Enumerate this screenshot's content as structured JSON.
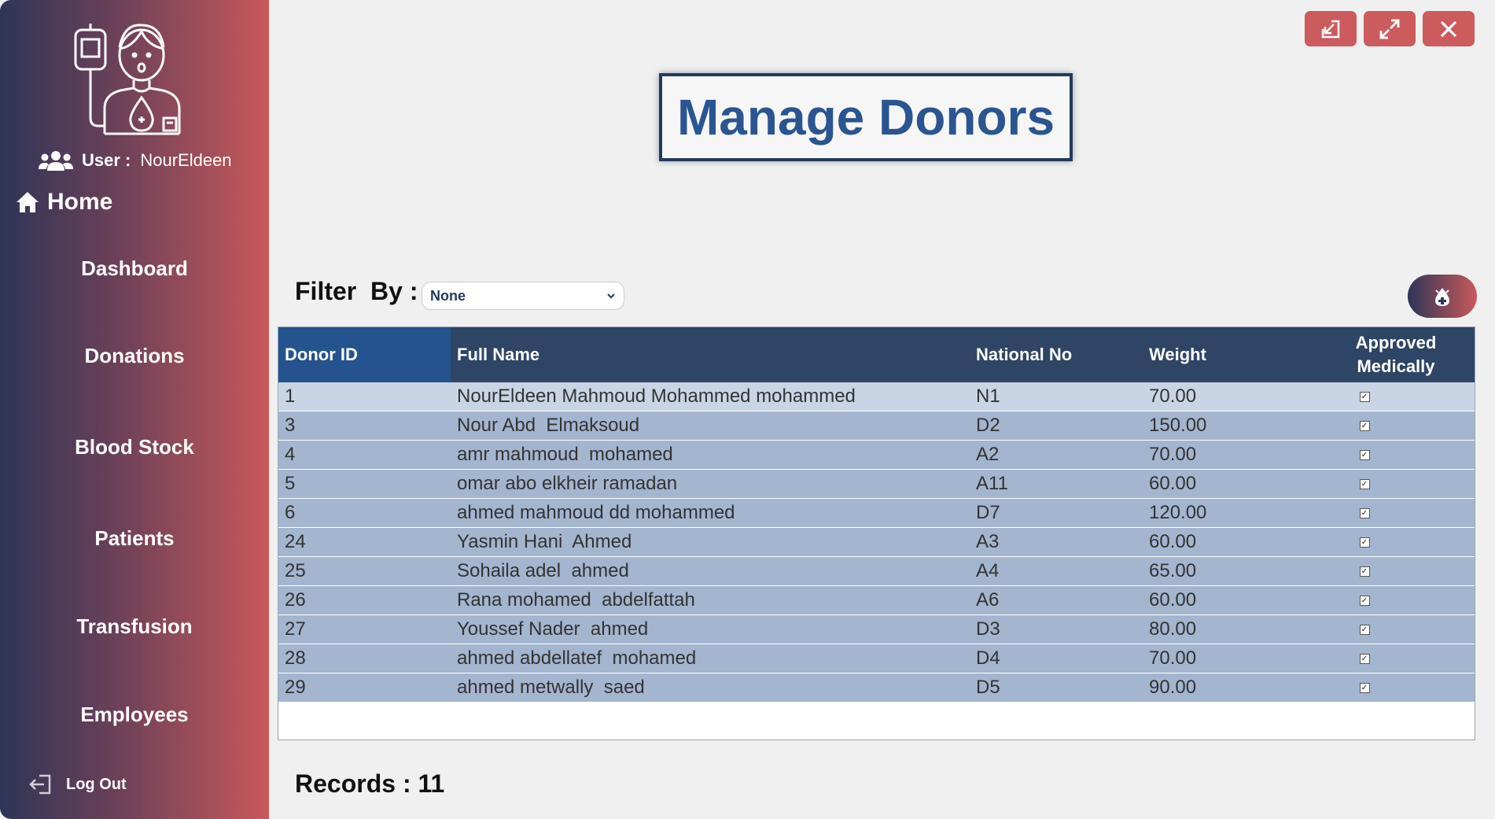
{
  "sidebar": {
    "user_label": "User :",
    "user_name": "NourEldeen",
    "home_label": "Home",
    "nav": [
      {
        "label": "Dashboard"
      },
      {
        "label": "Donations"
      },
      {
        "label": "Blood Stock"
      },
      {
        "label": "Patients"
      },
      {
        "label": "Transfusion"
      },
      {
        "label": "Employees"
      }
    ],
    "logout_label": "Log Out"
  },
  "window_controls": {
    "icons": [
      "minimize-icon",
      "maximize-icon",
      "close-icon"
    ],
    "color": "#cc5b5d"
  },
  "main": {
    "title": "Manage Donors",
    "filter_label": "Filter  By :",
    "filter_value": "None",
    "records_label": "Records : 11"
  },
  "table": {
    "columns": [
      "Donor ID",
      "Full Name",
      "National No",
      "Weight",
      "Approved Medically"
    ],
    "rows": [
      {
        "id": "1",
        "name": "NourEldeen Mahmoud Mohammed mohammed",
        "national": "N1",
        "weight": "70.00",
        "approved": true
      },
      {
        "id": "3",
        "name": "Nour Abd  Elmaksoud",
        "national": "D2",
        "weight": "150.00",
        "approved": true
      },
      {
        "id": "4",
        "name": "amr mahmoud  mohamed",
        "national": "A2",
        "weight": "70.00",
        "approved": true
      },
      {
        "id": "5",
        "name": "omar abo elkheir ramadan",
        "national": "A11",
        "weight": "60.00",
        "approved": true
      },
      {
        "id": "6",
        "name": "ahmed mahmoud dd mohammed",
        "national": "D7",
        "weight": "120.00",
        "approved": true
      },
      {
        "id": "24",
        "name": "Yasmin Hani  Ahmed",
        "national": "A3",
        "weight": "60.00",
        "approved": true
      },
      {
        "id": "25",
        "name": "Sohaila adel  ahmed",
        "national": "A4",
        "weight": "65.00",
        "approved": true
      },
      {
        "id": "26",
        "name": "Rana mohamed  abdelfattah",
        "national": "A6",
        "weight": "60.00",
        "approved": true
      },
      {
        "id": "27",
        "name": "Youssef Nader  ahmed",
        "national": "D3",
        "weight": "80.00",
        "approved": true
      },
      {
        "id": "28",
        "name": "ahmed abdellatef  mohamed",
        "national": "D4",
        "weight": "70.00",
        "approved": true
      },
      {
        "id": "29",
        "name": "ahmed metwally  saed",
        "national": "D5",
        "weight": "90.00",
        "approved": true
      }
    ]
  },
  "colors": {
    "title": "#2a5590",
    "header": "#2f4565",
    "row": "#a4b5cf",
    "accent": "#cc5b5d"
  }
}
